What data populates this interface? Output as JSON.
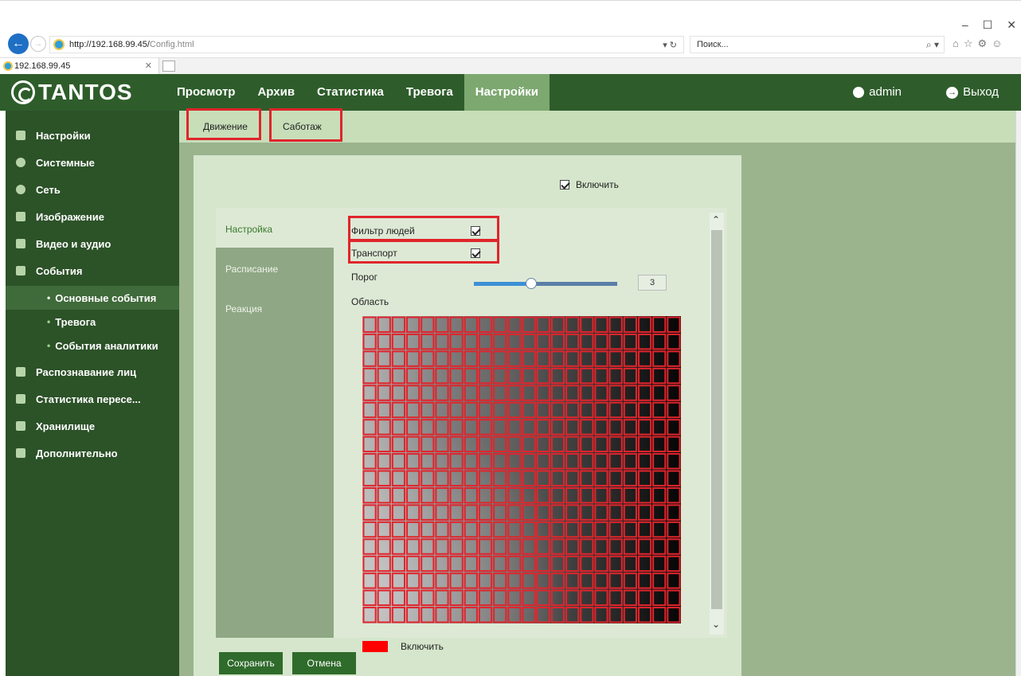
{
  "browser": {
    "url_host": "http://192.168.99.45/",
    "url_path": "Config.html",
    "addr_tools": "▾ ↻",
    "search_placeholder": "Поиск...",
    "search_tools": "⌕ ▾",
    "tab_title": "192.168.99.45",
    "tab_close": "✕",
    "window_controls": [
      "–",
      "☐",
      "✕"
    ],
    "fav_icons": [
      "⌂",
      "☆",
      "⚙",
      "☺"
    ]
  },
  "header": {
    "logo_text": "TANTOS",
    "nav": [
      "Просмотр",
      "Архив",
      "Статистика",
      "Тревога",
      "Настройки"
    ],
    "active_nav": "Настройки",
    "user": "admin",
    "logout": "Выход",
    "colors": {
      "bar": "#2e5d2b",
      "active": "#7da870"
    }
  },
  "sidebar": {
    "items": [
      {
        "label": "Настройки",
        "icon": "settings-list-icon"
      },
      {
        "label": "Системные",
        "icon": "info-icon"
      },
      {
        "label": "Сеть",
        "icon": "globe-icon"
      },
      {
        "label": "Изображение",
        "icon": "image-icon"
      },
      {
        "label": "Видео и аудио",
        "icon": "monitor-icon"
      },
      {
        "label": "События",
        "icon": "bell-icon"
      }
    ],
    "subitems": [
      "Основные события",
      "Тревога",
      "События аналитики"
    ],
    "active_subitem": "Основные события",
    "items_bottom": [
      {
        "label": "Распознавание лиц",
        "icon": "face-icon"
      },
      {
        "label": "Статистика пересе...",
        "icon": "bar-chart-icon"
      },
      {
        "label": "Хранилище",
        "icon": "storage-icon"
      },
      {
        "label": "Дополнительно",
        "icon": "tools-icon"
      }
    ]
  },
  "subtabs": [
    "Движение",
    "Саботаж"
  ],
  "panel": {
    "enable_label": "Включить",
    "enable_checked": true,
    "left_tabs": [
      "Настройка",
      "Расписание",
      "Реакция"
    ],
    "active_left_tab": "Настройка",
    "people_filter_label": "Фильтр людей",
    "people_filter_checked": true,
    "transport_label": "Транспорт",
    "transport_checked": true,
    "threshold_label": "Порог",
    "threshold_value": "3",
    "threshold_fraction": 0.4,
    "area_label": "Область",
    "grid": {
      "cols": 22,
      "rows": 18,
      "line_color": "#e0252c"
    },
    "legend_label": "Включить",
    "legend_color": "#ff0000"
  },
  "buttons": {
    "save": "Сохранить",
    "cancel": "Отмена"
  }
}
